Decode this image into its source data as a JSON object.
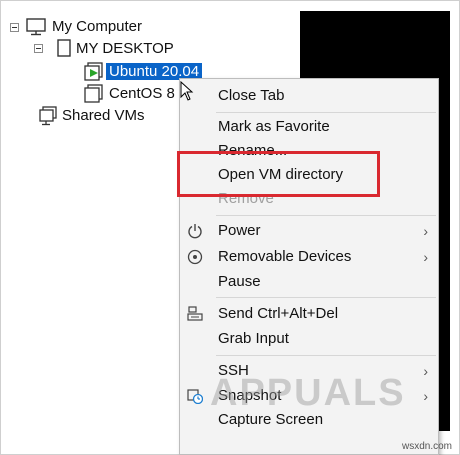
{
  "tree": {
    "items": [
      {
        "label": "My Computer",
        "icon": "monitor-icon"
      },
      {
        "label": "MY DESKTOP",
        "icon": "document-icon"
      },
      {
        "label": "Ubuntu 20.04",
        "icon": "vm-running-icon",
        "selected": true
      },
      {
        "label": "CentOS 8",
        "icon": "vm-icon"
      },
      {
        "label": "Shared VMs",
        "icon": "shared-vms-icon"
      }
    ]
  },
  "context_menu": {
    "items": [
      {
        "label": "Close Tab",
        "disabled": false
      },
      {
        "label": "Mark as Favorite",
        "disabled": false
      },
      {
        "label": "Rename...",
        "disabled": false
      },
      {
        "label": "Open VM directory",
        "disabled": false,
        "highlighted": true
      },
      {
        "label": "Remove",
        "disabled": true
      },
      {
        "label": "Power",
        "icon": "power-icon",
        "submenu": true
      },
      {
        "label": "Removable Devices",
        "icon": "disc-icon",
        "submenu": true
      },
      {
        "label": "Pause"
      },
      {
        "label": "Send Ctrl+Alt+Del",
        "icon": "keyboard-icon"
      },
      {
        "label": "Grab Input"
      },
      {
        "label": "SSH",
        "submenu": true
      },
      {
        "label": "Snapshot",
        "icon": "snapshot-icon",
        "submenu": true
      },
      {
        "label": "Capture Screen"
      }
    ],
    "submenu_arrow": "›"
  },
  "highlight_color": "#d9282f",
  "selection_color": "#0a64c8",
  "watermark": "APPUALS",
  "credit": "wsxdn.com"
}
